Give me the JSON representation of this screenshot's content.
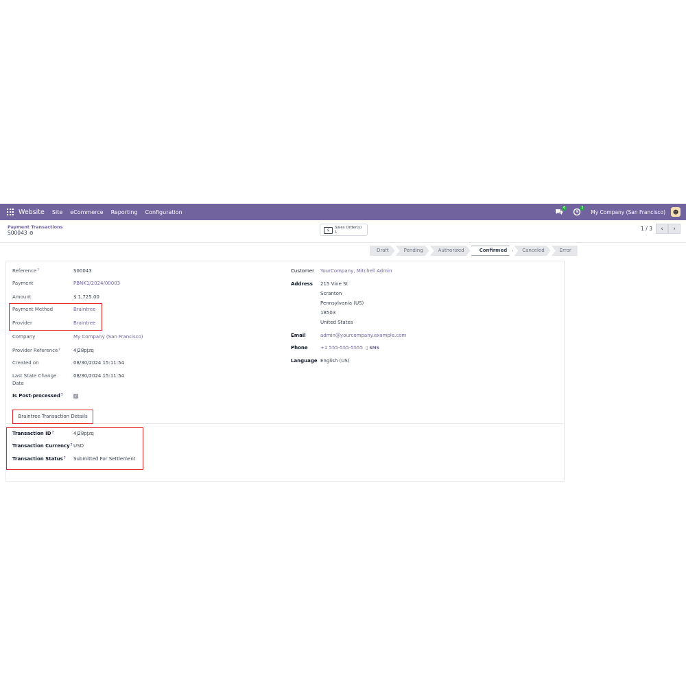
{
  "navbar": {
    "brand": "Website",
    "items": [
      "Site",
      "eCommerce",
      "Reporting",
      "Configuration"
    ],
    "messages_count": "6",
    "activities_count": "3",
    "company": "My Company (San Francisco)"
  },
  "breadcrumb": {
    "parent": "Payment Transactions",
    "current": "S00043"
  },
  "smart_button": {
    "label": "Sales Order(s)",
    "count": "1"
  },
  "pager": {
    "value": "1 / 3"
  },
  "status_stages": [
    "Draft",
    "Pending",
    "Authorized",
    "Confirmed",
    "Canceled",
    "Error"
  ],
  "active_stage": "Confirmed",
  "left_fields": {
    "reference_label": "Reference",
    "reference": "S00043",
    "payment_label": "Payment",
    "payment": "PBNK1/2024/00003",
    "amount_label": "Amount",
    "amount": "$ 1,725.00",
    "payment_method_label": "Payment Method",
    "payment_method": "Braintree",
    "provider_label": "Provider",
    "provider": "Braintree",
    "company_label": "Company",
    "company": "My Company (San Francisco)",
    "provider_reference_label": "Provider Reference",
    "provider_reference": "4j28pjzq",
    "created_on_label": "Created on",
    "created_on": "08/30/2024 15:11:54",
    "last_state_change_label_1": "Last State Change",
    "last_state_change_label_2": "Date",
    "last_state_change": "08/30/2024 15:11:54",
    "post_processed_label": "Is Post-processed"
  },
  "right_fields": {
    "customer_label": "Customer",
    "customer": "YourCompany, Mitchell Admin",
    "address_label": "Address",
    "address_lines": [
      "215 Vine St",
      "Scranton",
      "Pennsylvania (US)",
      "18503",
      "United States"
    ],
    "email_label": "Email",
    "email": "admin@yourcompany.example.com",
    "phone_label": "Phone",
    "phone": "+1 555-555-5555",
    "sms_label": "SMS",
    "language_label": "Language",
    "language": "English (US)"
  },
  "tab": {
    "label": "Braintree Transaction Details"
  },
  "braintree": {
    "transaction_id_label": "Transaction ID",
    "transaction_id": "4j28pjzq",
    "currency_label": "Transaction Currency",
    "currency": "USD",
    "status_label": "Transaction Status",
    "status": "Submitted For Settlement"
  },
  "colors": {
    "navbar": "#71639e",
    "link": "#71639e",
    "highlight_box": "#e32626"
  }
}
